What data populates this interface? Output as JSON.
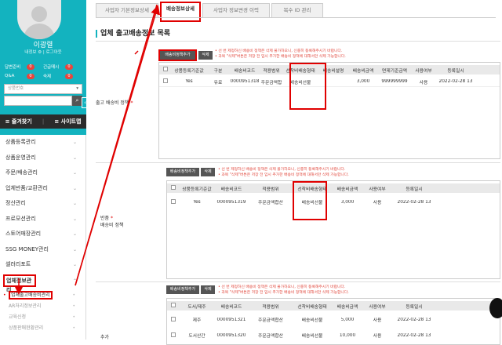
{
  "sidebar": {
    "username": "이광렬",
    "userlinks": "내정보 ⚙ | 로그아웃",
    "counters": [
      {
        "label": "답변준비",
        "count": "0"
      },
      {
        "label": "긴급메시",
        "count": "0"
      },
      {
        "label": "Q&A",
        "count": "0"
      },
      {
        "label": "숙제",
        "count": "0"
      }
    ],
    "search_select": "상품번호",
    "quick_links": [
      "≡ 즐겨찾기",
      "≡ 사이트맵"
    ],
    "menu": [
      "상품등록관리",
      "상품운영관리",
      "주문/배송관리",
      "업체반품/교환관리",
      "정산관리",
      "프로모션관리",
      "스토어매장관리",
      "SSG MONEY관리",
      "셀러리포트"
    ],
    "active_menu": "업체정보관리",
    "submenu": [
      "업체출고배송비관리",
      "AR처리정보관리",
      "교육신청",
      "상품판매현황관리"
    ]
  },
  "tabs": [
    "사업자 기본정보상세",
    "배송정보상세",
    "사업자 정보변경 이력",
    "복수 ID 관리"
  ],
  "page_title": "업체 출고배송정보 목록",
  "notes": [
    "• 선 번 제정하신 배송비 정책은 삭제 불가하오니, 신중히 등록해주시기 바랍니다.",
    "• 과목 \"삭제\"버튼은 저장 전 임시 추가한 배송비 정책에 대해서만 삭제 가능합니다."
  ],
  "sections": [
    {
      "label": "출고 배송비 정책",
      "add_label": "배송비정책추가",
      "del_label": "삭제",
      "headers": [
        "상품등록기준값",
        "구분",
        "배송비코드",
        "적용범위",
        "선착비배송형태",
        "배송비설명",
        "배송비금액",
        "면제기준금액",
        "사용여부",
        "등록일시"
      ],
      "rows": [
        [
          "Yes",
          "유료",
          "0000951318",
          "주문금액합",
          "배송비선불",
          "",
          "3,000",
          "999999999",
          "사용",
          "2022-02-28 13"
        ]
      ]
    },
    {
      "label": "반품 배송비 정책",
      "add_label": "배송비정책추가",
      "del_label": "삭제",
      "headers": [
        "상품등록기준값",
        "배송비코드",
        "적용범위",
        "선착비배송형태",
        "배송비금액",
        "사용여부",
        "등록일시"
      ],
      "rows": [
        [
          "Yes",
          "0000951319",
          "주문금액합산",
          "배송비선불",
          "3,000",
          "사용",
          "2022-02-28 13"
        ]
      ]
    },
    {
      "label": "추가 배송비 정책",
      "add_label": "배송비정책추가",
      "del_label": "삭제",
      "headers": [
        "도서/제주",
        "배송비코드",
        "적용범위",
        "선착비배송형태",
        "배송비금액",
        "사용여부",
        "등록일시"
      ],
      "rows": [
        [
          "제주",
          "0000951321",
          "주문금액합산",
          "배송비선불",
          "5,000",
          "사용",
          "2022-02-28 13"
        ],
        [
          "도서산간",
          "0000951320",
          "주문금액합산",
          "배송비선불",
          "10,000",
          "사용",
          "2022-02-28 13"
        ]
      ]
    }
  ],
  "colors": {
    "accent": "#13b3bf",
    "highlight": "#e00000",
    "note": "#e24b40"
  }
}
